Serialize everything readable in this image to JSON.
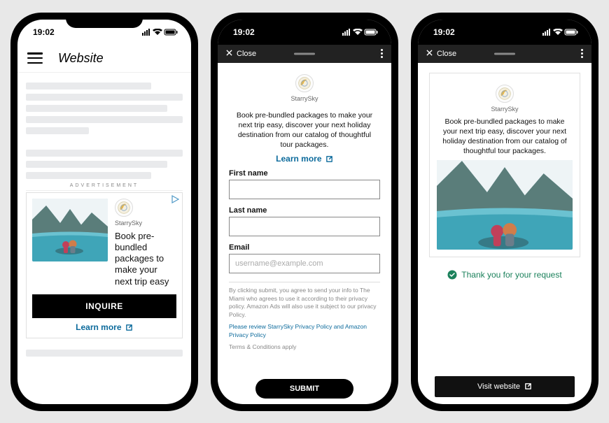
{
  "status": {
    "time": "19:02"
  },
  "phone1": {
    "site_title": "Website",
    "ad_label": "ADVERTISEMENT",
    "brand": "StarrySky",
    "ad_copy": "Book pre-bundled packages to make your next trip easy",
    "cta": "INQUIRE",
    "learn_more": "Learn more"
  },
  "phone2": {
    "close": "Close",
    "brand": "StarrySky",
    "description": "Book pre-bundled packages to make your next trip easy, discover your next holiday destination from our catalog of thoughtful tour packages.",
    "learn_more": "Learn more",
    "labels": {
      "first_name": "First name",
      "last_name": "Last name",
      "email": "Email"
    },
    "email_placeholder": "username@example.com",
    "disclaimer_line1": "By clicking submit, you agree to send your info to The Miami who agrees to use it according to their privacy policy. Amazon Ads will also use it subject to our privacy Policy.",
    "disclaimer_review": "Please review ",
    "pp1": "StarrySky Privacy Policy",
    "pp_and": " and ",
    "pp2": "Amazon Privacy Policy",
    "tc": "Terms & Conditions apply",
    "submit": "SUBMIT"
  },
  "phone3": {
    "close": "Close",
    "brand": "StarrySky",
    "description": "Book pre-bundled packages to make your next trip easy, discover your next holiday destination from our catalog of thoughtful tour packages.",
    "thanks": "Thank you for your request",
    "visit": "Visit website"
  }
}
